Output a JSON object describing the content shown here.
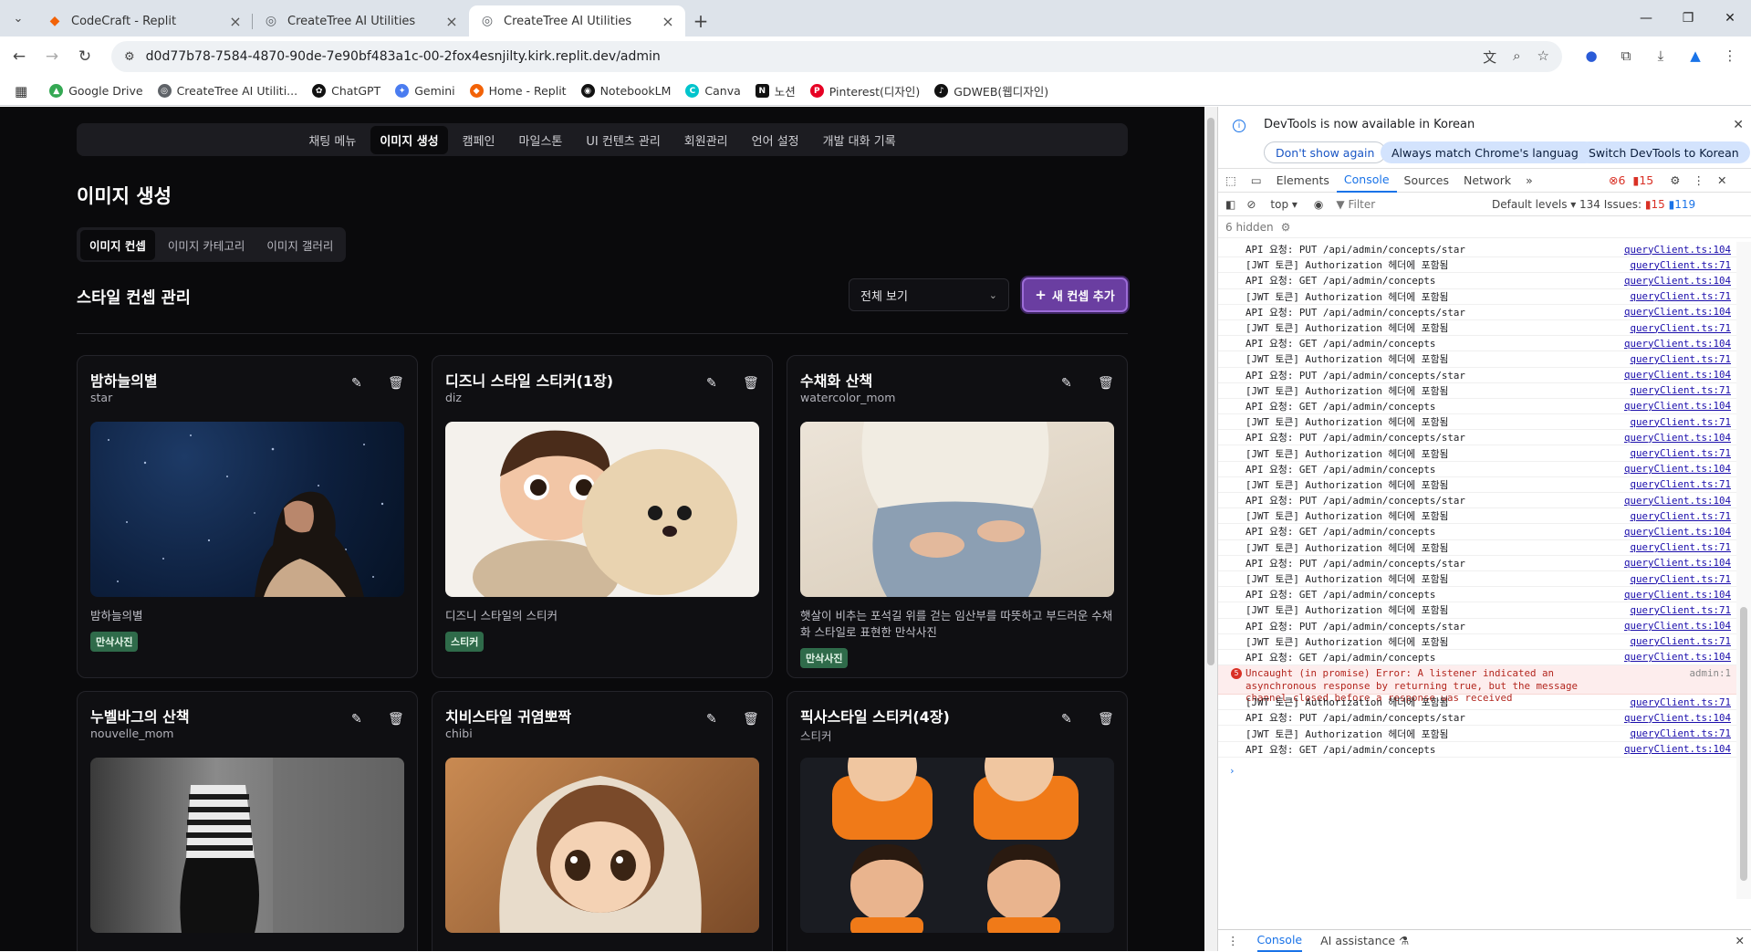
{
  "browser": {
    "tabs": [
      {
        "title": "CodeCraft - Replit",
        "active": false
      },
      {
        "title": "CreateTree AI Utilities",
        "active": false
      },
      {
        "title": "CreateTree AI Utilities",
        "active": true
      }
    ],
    "url": "d0d77b78-7584-4870-90de-7e90bf483a1c-00-2fox4esnjilty.kirk.replit.dev/admin",
    "bookmarks": [
      {
        "label": "Google Drive",
        "color": "#34a853"
      },
      {
        "label": "CreateTree AI Utiliti...",
        "color": "#5f6368"
      },
      {
        "label": "ChatGPT",
        "color": "#111111"
      },
      {
        "label": "Gemini",
        "color": "#4a7cf0"
      },
      {
        "label": "Home - Replit",
        "color": "#f26207"
      },
      {
        "label": "NotebookLM",
        "color": "#111111"
      },
      {
        "label": "Canva",
        "color": "#00c4cc"
      },
      {
        "label": "노션",
        "color": "#111111"
      },
      {
        "label": "Pinterest(디자인)",
        "color": "#e60023"
      },
      {
        "label": "GDWEB(웹디자인)",
        "color": "#111111"
      }
    ]
  },
  "app": {
    "nav": [
      "채팅 메뉴",
      "이미지 생성",
      "캠페인",
      "마일스톤",
      "UI 컨텐츠 관리",
      "회원관리",
      "언어 설정",
      "개발 대화 기록"
    ],
    "nav_active": 1,
    "page_title": "이미지 생성",
    "subtabs": [
      "이미지 컨셉",
      "이미지 카테고리",
      "이미지 갤러리"
    ],
    "section_title": "스타일 컨셉 관리",
    "filter_value": "전체 보기",
    "add_button": "새 컨셉 추가",
    "cards": [
      {
        "title": "밤하늘의별",
        "key": "star",
        "desc": "밤하늘의별",
        "badge": "만삭사진"
      },
      {
        "title": "디즈니 스타일 스티커(1장)",
        "key": "diz",
        "desc": "디즈니 스타일의 스티커",
        "badge": "스티커"
      },
      {
        "title": "수채화 산책",
        "key": "watercolor_mom",
        "desc": "햇살이 비추는 포석길 위를 걷는 임산부를 따뜻하고 부드러운 수채화 스타일로 표현한 만삭사진",
        "badge": "만삭사진"
      },
      {
        "title": "누벨바그의 산책",
        "key": "nouvelle_mom",
        "desc": "",
        "badge": ""
      },
      {
        "title": "치비스타일 귀염뽀짝",
        "key": "chibi",
        "desc": "",
        "badge": ""
      },
      {
        "title": "픽사스타일 스티커(4장)",
        "key": "스티커",
        "desc": "",
        "badge": ""
      }
    ]
  },
  "devtools": {
    "banner": "DevTools is now available in Korean",
    "btn_dont_show": "Don't show again",
    "btn_match": "Always match Chrome's language",
    "btn_switch": "Switch DevTools to Korean",
    "tabs": [
      "Elements",
      "Console",
      "Sources",
      "Network"
    ],
    "errors": "6",
    "warnings": "15",
    "context": "top",
    "filter_placeholder": "Filter",
    "levels": "Default levels",
    "issues_label": "134 Issues:",
    "issues_err": "15",
    "issues_info": "119",
    "hidden": "6 hidden",
    "logs": [
      {
        "text": "API 요청: PUT /api/admin/concepts/star",
        "src": "queryClient.ts:104"
      },
      {
        "text": "[JWT 토큰] Authorization 헤더에 포함됨",
        "src": "queryClient.ts:71"
      },
      {
        "text": "API 요청: GET /api/admin/concepts",
        "src": "queryClient.ts:104"
      },
      {
        "text": "[JWT 토큰] Authorization 헤더에 포함됨",
        "src": "queryClient.ts:71"
      },
      {
        "text": "API 요청: PUT /api/admin/concepts/star",
        "src": "queryClient.ts:104"
      },
      {
        "text": "[JWT 토큰] Authorization 헤더에 포함됨",
        "src": "queryClient.ts:71"
      },
      {
        "text": "API 요청: GET /api/admin/concepts",
        "src": "queryClient.ts:104"
      },
      {
        "text": "[JWT 토큰] Authorization 헤더에 포함됨",
        "src": "queryClient.ts:71"
      },
      {
        "text": "API 요청: PUT /api/admin/concepts/star",
        "src": "queryClient.ts:104"
      },
      {
        "text": "[JWT 토큰] Authorization 헤더에 포함됨",
        "src": "queryClient.ts:71"
      },
      {
        "text": "API 요청: GET /api/admin/concepts",
        "src": "queryClient.ts:104"
      },
      {
        "text": "[JWT 토큰] Authorization 헤더에 포함됨",
        "src": "queryClient.ts:71"
      },
      {
        "text": "API 요청: PUT /api/admin/concepts/star",
        "src": "queryClient.ts:104"
      },
      {
        "text": "[JWT 토큰] Authorization 헤더에 포함됨",
        "src": "queryClient.ts:71"
      },
      {
        "text": "API 요청: GET /api/admin/concepts",
        "src": "queryClient.ts:104"
      },
      {
        "text": "[JWT 토큰] Authorization 헤더에 포함됨",
        "src": "queryClient.ts:71"
      },
      {
        "text": "API 요청: PUT /api/admin/concepts/star",
        "src": "queryClient.ts:104"
      },
      {
        "text": "[JWT 토큰] Authorization 헤더에 포함됨",
        "src": "queryClient.ts:71"
      },
      {
        "text": "API 요청: GET /api/admin/concepts",
        "src": "queryClient.ts:104"
      },
      {
        "text": "[JWT 토큰] Authorization 헤더에 포함됨",
        "src": "queryClient.ts:71"
      },
      {
        "text": "API 요청: PUT /api/admin/concepts/star",
        "src": "queryClient.ts:104"
      },
      {
        "text": "[JWT 토큰] Authorization 헤더에 포함됨",
        "src": "queryClient.ts:71"
      },
      {
        "text": "API 요청: GET /api/admin/concepts",
        "src": "queryClient.ts:104"
      },
      {
        "text": "[JWT 토큰] Authorization 헤더에 포함됨",
        "src": "queryClient.ts:71"
      },
      {
        "text": "API 요청: PUT /api/admin/concepts/star",
        "src": "queryClient.ts:104"
      },
      {
        "text": "[JWT 토큰] Authorization 헤더에 포함됨",
        "src": "queryClient.ts:71"
      },
      {
        "text": "API 요청: GET /api/admin/concepts",
        "src": "queryClient.ts:104"
      }
    ],
    "error_log": {
      "count": "5",
      "text": "Uncaught (in promise) Error: A listener indicated an asynchronous response by returning true, but the message channel closed before a response was received",
      "src": "admin:1"
    },
    "logs_after": [
      {
        "text": "[JWT 토큰] Authorization 헤더에 포함됨",
        "src": "queryClient.ts:71"
      },
      {
        "text": "API 요청: PUT /api/admin/concepts/star",
        "src": "queryClient.ts:104"
      },
      {
        "text": "[JWT 토큰] Authorization 헤더에 포함됨",
        "src": "queryClient.ts:71"
      },
      {
        "text": "API 요청: GET /api/admin/concepts",
        "src": "queryClient.ts:104"
      }
    ],
    "drawer_tabs": [
      "Console",
      "AI assistance"
    ]
  }
}
